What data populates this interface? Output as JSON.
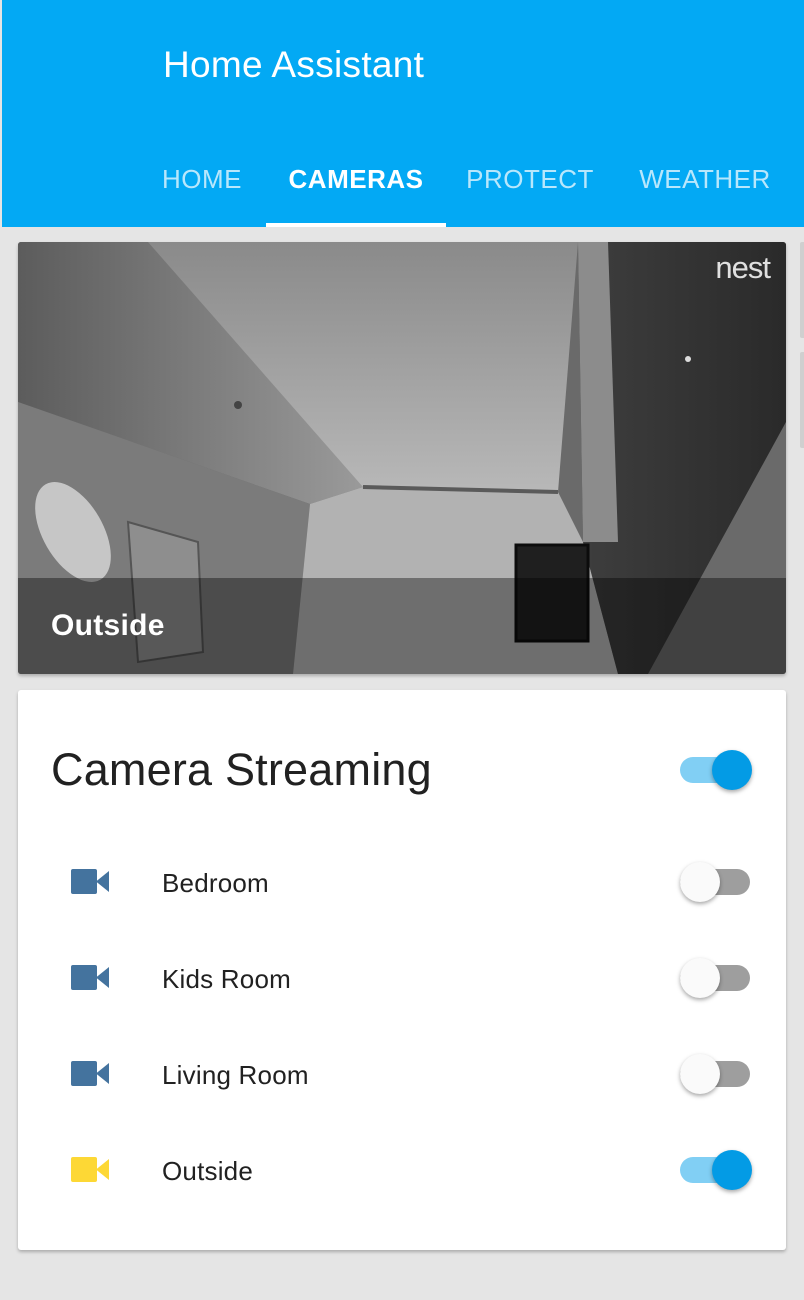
{
  "header": {
    "title": "Home Assistant",
    "color": "#03a9f4",
    "tabs": [
      {
        "label": "HOME",
        "active": false
      },
      {
        "label": "CAMERAS",
        "active": true
      },
      {
        "label": "PROTECT",
        "active": false
      },
      {
        "label": "WEATHER",
        "active": false
      }
    ]
  },
  "camera_card": {
    "caption": "Outside",
    "watermark": "nest"
  },
  "streaming_card": {
    "title": "Camera Streaming",
    "master_toggle_on": true,
    "rows": [
      {
        "label": "Bedroom",
        "icon": "video-camera-icon",
        "icon_color": "#44739e",
        "on": false
      },
      {
        "label": "Kids Room",
        "icon": "video-camera-icon",
        "icon_color": "#44739e",
        "on": false
      },
      {
        "label": "Living Room",
        "icon": "video-camera-icon",
        "icon_color": "#44739e",
        "on": false
      },
      {
        "label": "Outside",
        "icon": "video-camera-icon",
        "icon_color": "#fdd835",
        "on": true
      }
    ]
  },
  "colors": {
    "toggle_on_thumb": "#039be5",
    "toggle_on_track": "#81cff4",
    "toggle_off_track": "#9e9e9e"
  }
}
